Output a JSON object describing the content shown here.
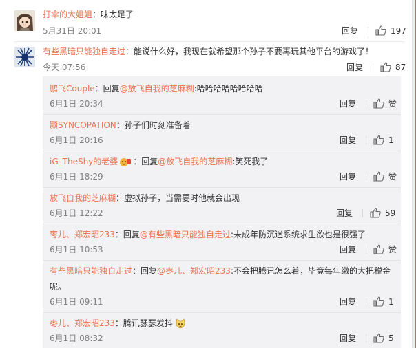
{
  "comments": [
    {
      "user": "打伞的大姐姐",
      "separator": "：",
      "text": "味太足了",
      "time": "5月31日 20:01",
      "reply": "回复",
      "likes": "197"
    },
    {
      "user": "有些黑暗只能独自走过",
      "separator": "：",
      "text": "能说什么好，我现在就希望那个孙子不要再玩其他平台的游戏了！",
      "time": "今天 07:56",
      "reply": "回复",
      "likes": "87"
    }
  ],
  "replies": [
    {
      "user": "鹏飞Couple",
      "sep1": "：回复",
      "mention": "@放飞自我的芝麻糊",
      "text": ":哈哈哈哈哈哈哈哈",
      "time": "6月1日 20:34",
      "reply": "回复",
      "likes": "赞"
    },
    {
      "user": "颢SYNCOPATION",
      "sep1": "：",
      "text": "孙子们时刻准备着",
      "time": "6月1日 20:16",
      "reply": "回复",
      "likes": "1"
    },
    {
      "user": "iG_TheShy的老婆",
      "sep1": "：回复",
      "mention": "@放飞自我的芝麻糊",
      "text": ":笑死我了",
      "time": "6月1日 18:29",
      "reply": "回复",
      "likes": "赞"
    },
    {
      "user": "放飞自我的芝麻糊",
      "sep1": "：",
      "text": "虚拟孙子，当需要时他就会出现",
      "time": "6月1日 12:22",
      "reply": "回复",
      "likes": "59"
    },
    {
      "user": "枣儿、郑宏昭233",
      "sep1": "：回复",
      "mention": "@有些黑暗只能独自走过",
      "text": ":未成年防沉迷系统求生欲也是很强了",
      "time": "6月1日 10:53",
      "reply": "回复",
      "likes": "赞"
    },
    {
      "user": "有些黑暗只能独自走过",
      "sep1": "：回复",
      "mention": "@枣儿、郑宏昭233",
      "text": ":不会把腾讯怎么着，毕竟每年缴的大把税金",
      "text_line2": "呢。",
      "time": "6月1日 09:11",
      "reply": "回复",
      "likes": "1"
    },
    {
      "user": "枣儿、郑宏昭233",
      "sep1": "：",
      "text": "腾讯瑟瑟发抖",
      "time": "6月1日 08:32",
      "reply": "回复",
      "likes": "5"
    }
  ],
  "icons": {
    "like": "thumbs-up-icon",
    "emoji_cat": "cat-face-emoji",
    "emoji_fire": "badge-emoji",
    "avatar1": "anime-girl-avatar",
    "avatar2": "blue-star-avatar"
  },
  "colors": {
    "username": "#eb7350",
    "meta": "#808080",
    "text": "#333333",
    "reply_panel": "#f2f2f5",
    "accent_edge": "#c96b6b"
  }
}
